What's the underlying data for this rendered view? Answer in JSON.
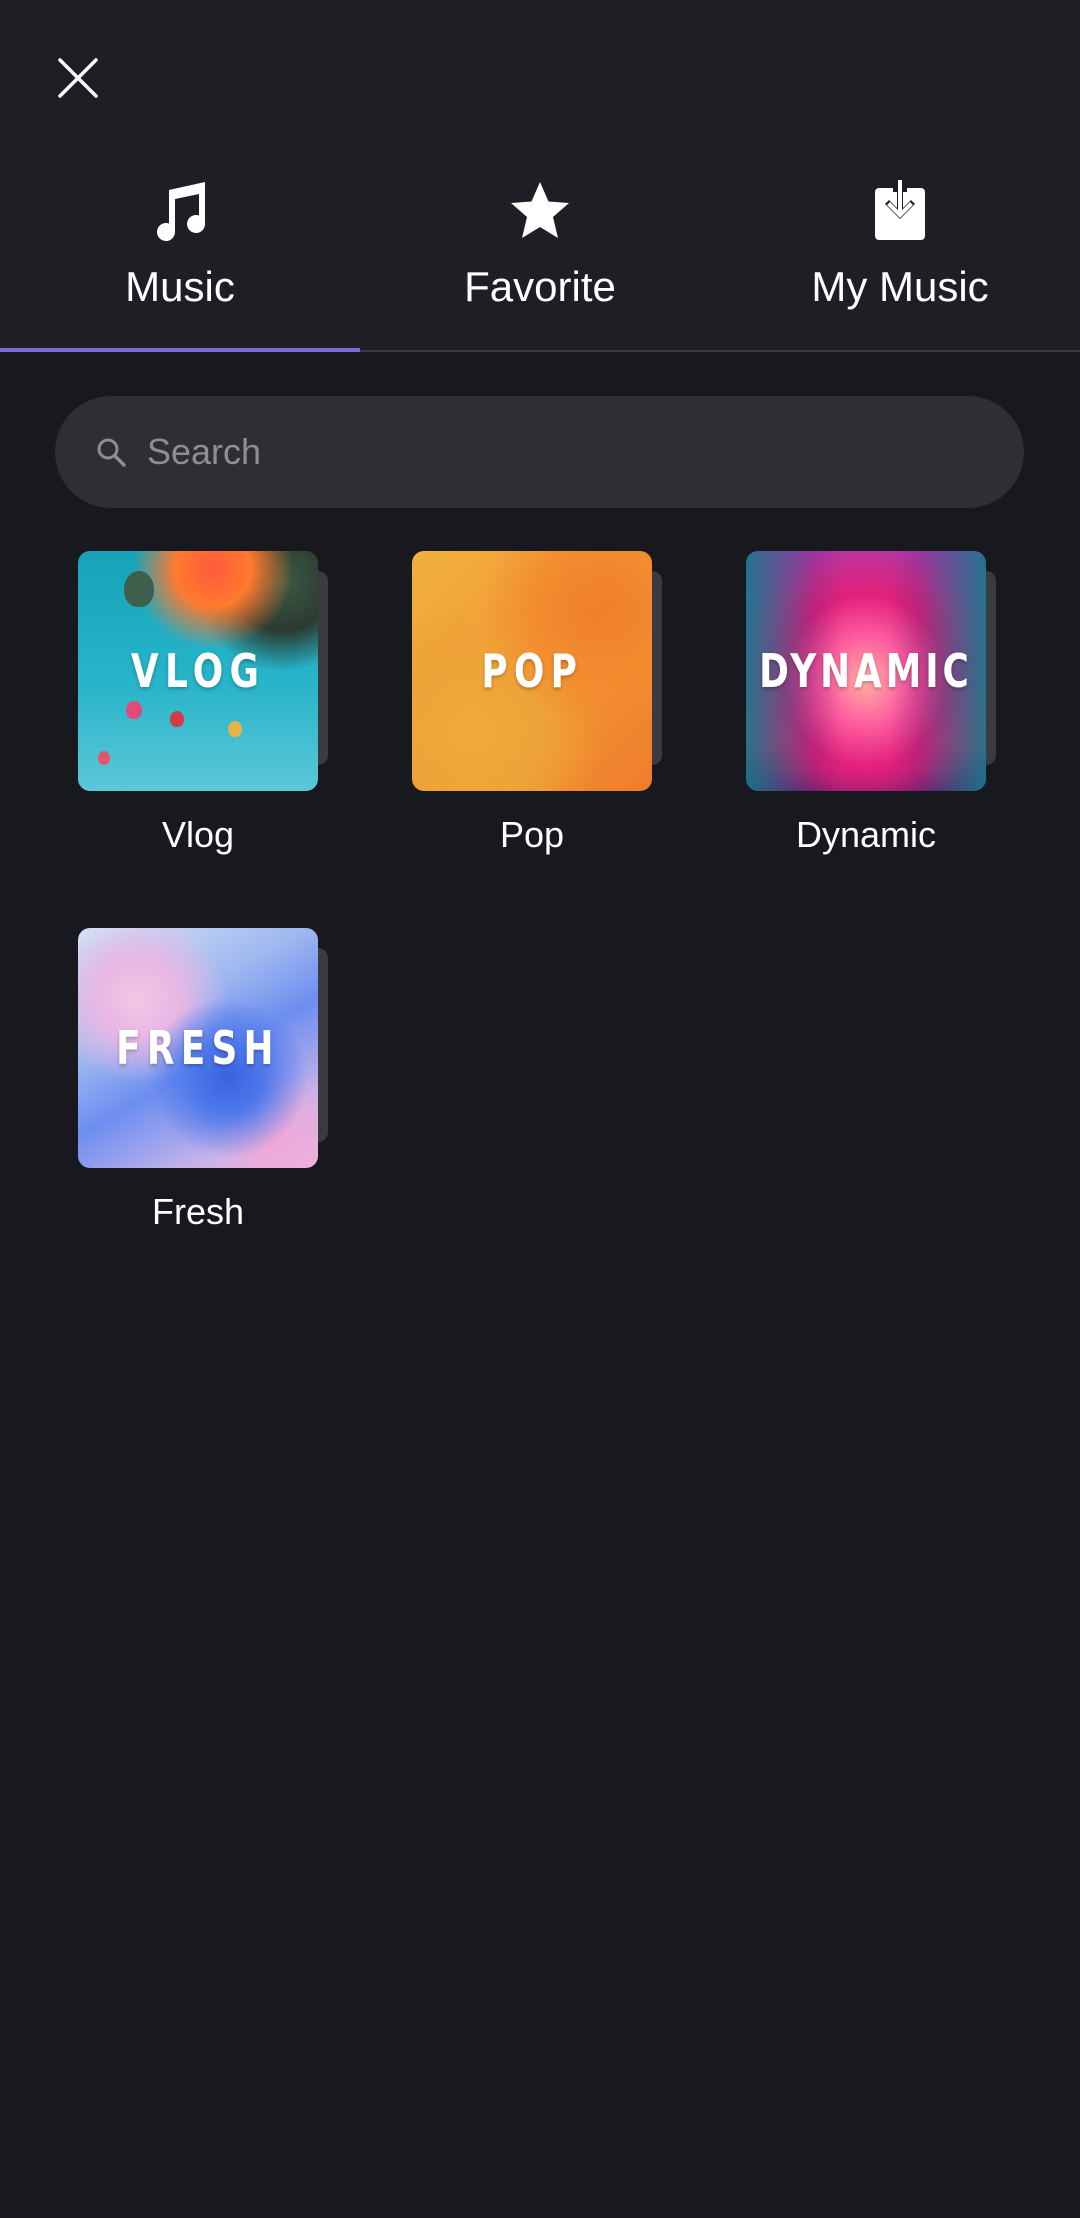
{
  "header": {
    "close_icon": "close-icon"
  },
  "tabs": [
    {
      "label": "Music",
      "icon": "music-note-icon",
      "active": true
    },
    {
      "label": "Favorite",
      "icon": "star-icon",
      "active": false
    },
    {
      "label": "My Music",
      "icon": "download-icon",
      "active": false
    }
  ],
  "search": {
    "placeholder": "Search",
    "value": ""
  },
  "categories": [
    {
      "label": "Vlog",
      "cover_text": "VLOG"
    },
    {
      "label": "Pop",
      "cover_text": "POP"
    },
    {
      "label": "Dynamic",
      "cover_text": "DYNAMIC"
    },
    {
      "label": "Fresh",
      "cover_text": "FRESH"
    }
  ],
  "colors": {
    "background": "#18191e",
    "header_background": "#1e1f25",
    "tab_indicator": "#7b6cd9",
    "search_background": "#2e2f35",
    "placeholder": "#8d8e94"
  }
}
